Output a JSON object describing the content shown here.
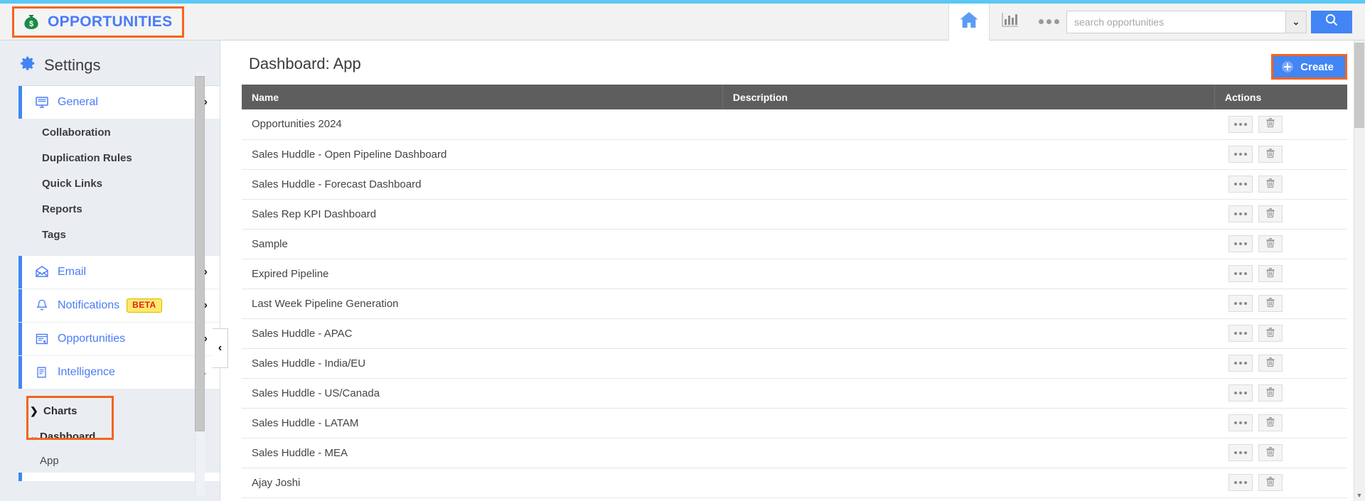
{
  "header": {
    "brand_label": "OPPORTUNITIES",
    "brand_icon": "money-bag-icon",
    "home_icon": "home-icon",
    "chart_icon": "bar-chart-icon",
    "more_icon": "ellipsis-icon",
    "search_placeholder": "search opportunities",
    "search_value": "",
    "search_caret_glyph": "⌄",
    "search_button_icon": "search-icon",
    "accent_color": "#5bc8f5",
    "brand_color": "#4a7bf7",
    "highlight_color": "#f4641e"
  },
  "sidebar": {
    "title": "Settings",
    "gear_icon": "gear-icon",
    "items": [
      {
        "label": "General",
        "icon": "monitor-icon",
        "chevron": "›"
      },
      {
        "label": "Email",
        "icon": "envelope-icon",
        "chevron": "›"
      },
      {
        "label": "Notifications",
        "icon": "bell-icon",
        "chevron": "›",
        "badge": "BETA"
      },
      {
        "label": "Opportunities",
        "icon": "window-list-icon",
        "chevron": "›"
      },
      {
        "label": "Intelligence",
        "icon": "document-lines-icon",
        "chevron": "⌄"
      }
    ],
    "general_children": [
      "Collaboration",
      "Duplication Rules",
      "Quick Links",
      "Reports",
      "Tags"
    ],
    "intelligence_children": [
      {
        "label": "Charts",
        "chevron": "❯",
        "expanded": false
      },
      {
        "label": "Dashboard",
        "chevron": "⌄",
        "expanded": true,
        "highlighted": true
      }
    ],
    "dashboard_children": [
      "App"
    ],
    "collapse_handle_glyph": "‹"
  },
  "main": {
    "page_title": "Dashboard: App",
    "create_label": "Create",
    "create_icon": "plus-circle-icon",
    "table": {
      "columns": [
        "Name",
        "Description",
        "Actions"
      ],
      "rows": [
        {
          "name": "Opportunities 2024",
          "description": ""
        },
        {
          "name": "Sales Huddle - Open Pipeline Dashboard",
          "description": ""
        },
        {
          "name": "Sales Huddle - Forecast Dashboard",
          "description": ""
        },
        {
          "name": "Sales Rep KPI Dashboard",
          "description": ""
        },
        {
          "name": "Sample",
          "description": ""
        },
        {
          "name": "Expired Pipeline",
          "description": ""
        },
        {
          "name": "Last Week Pipeline Generation",
          "description": ""
        },
        {
          "name": "Sales Huddle - APAC",
          "description": ""
        },
        {
          "name": "Sales Huddle - India/EU",
          "description": ""
        },
        {
          "name": "Sales Huddle - US/Canada",
          "description": ""
        },
        {
          "name": "Sales Huddle - LATAM",
          "description": ""
        },
        {
          "name": "Sales Huddle - MEA",
          "description": ""
        },
        {
          "name": "Ajay Joshi",
          "description": ""
        }
      ],
      "row_action_more_icon": "ellipsis-icon",
      "row_action_delete_icon": "trash-icon"
    }
  }
}
